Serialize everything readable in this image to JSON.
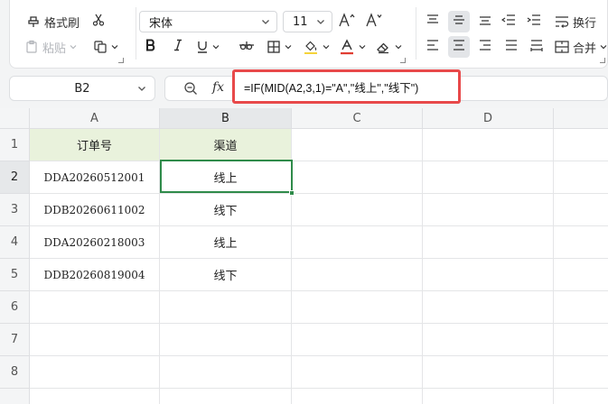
{
  "ribbon": {
    "format_painter_label": "格式刷",
    "paste_label": "粘贴",
    "font_name": "宋体",
    "font_size": "11",
    "wrap_label": "换行",
    "merge_label": "合并"
  },
  "formula_bar": {
    "name_box": "B2",
    "fx_label": "fx",
    "formula": "=IF(MID(A2,3,1)=\"A\",\"线上\",\"线下\")"
  },
  "sheet": {
    "columns": [
      "A",
      "B",
      "C",
      "D"
    ],
    "rows": [
      "1",
      "2",
      "3",
      "4",
      "5",
      "6",
      "7",
      "8"
    ],
    "header": {
      "a": "订单号",
      "b": "渠道"
    },
    "data": [
      {
        "a": "DDA20260512001",
        "b": "线上"
      },
      {
        "a": "DDB20260611002",
        "b": "线下"
      },
      {
        "a": "DDA20260218003",
        "b": "线上"
      },
      {
        "a": "DDB20260819004",
        "b": "线下"
      }
    ],
    "selected_cell": "B2"
  },
  "colors": {
    "header_fill": "#e9f2dc",
    "selection": "#2f8b4a",
    "highlight_frame": "#e8494a",
    "font_color_bar": "#e03c31"
  }
}
